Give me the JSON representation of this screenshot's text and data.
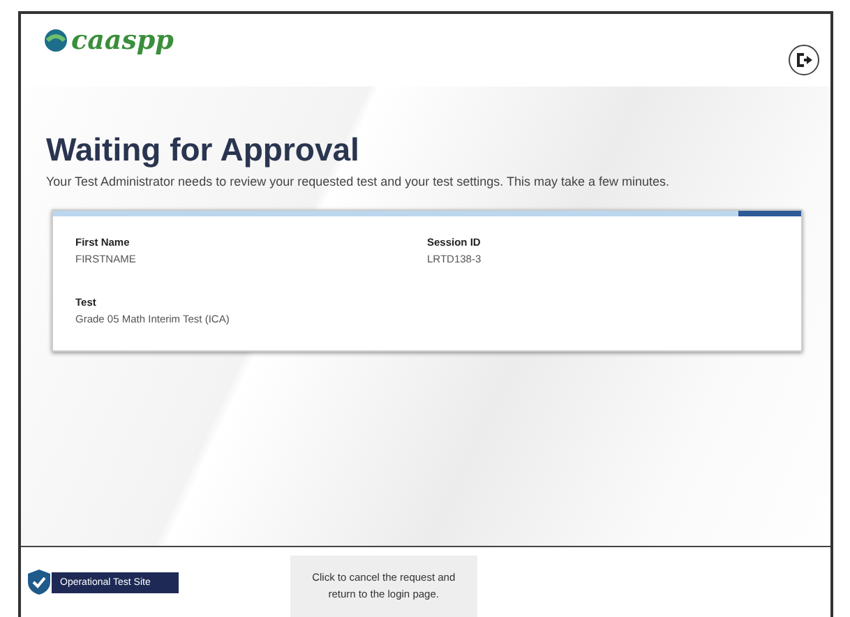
{
  "header": {
    "logo": "caaspp"
  },
  "title": "Waiting for Approval",
  "message": "Your Test Administrator needs to review your requested test and your test settings. This may take a few minutes.",
  "card": {
    "fields": [
      {
        "label": "First Name",
        "value": "FIRSTNAME"
      },
      {
        "label": "Session ID",
        "value": "LRTD138-3"
      },
      {
        "label": "Test",
        "value": "Grade 05 Math Interim Test (ICA)"
      }
    ]
  },
  "footer": {
    "site_badge": "Operational Test Site",
    "cancel_button": "Click to cancel the request and return to the login page."
  }
}
